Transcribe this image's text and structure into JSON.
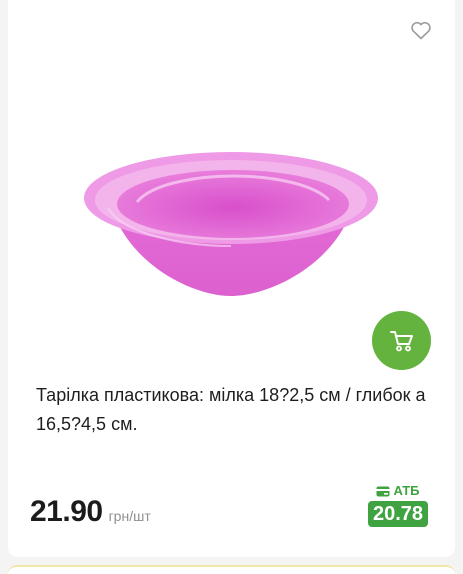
{
  "product": {
    "title": "Тарілка пластикова: мілка 18?2,5 см / глибок а 16,5?4,5 см.",
    "price": "21.90",
    "unit": "грн/шт",
    "store_label": "АТБ",
    "store_price": "20.78"
  },
  "icons": {
    "favorite": "heart-outline-icon",
    "cart": "shopping-cart-icon",
    "store": "card-icon"
  },
  "colors": {
    "accent_green": "#63b33e",
    "store_green": "#3fa342",
    "product_pink": "#e470d8"
  }
}
